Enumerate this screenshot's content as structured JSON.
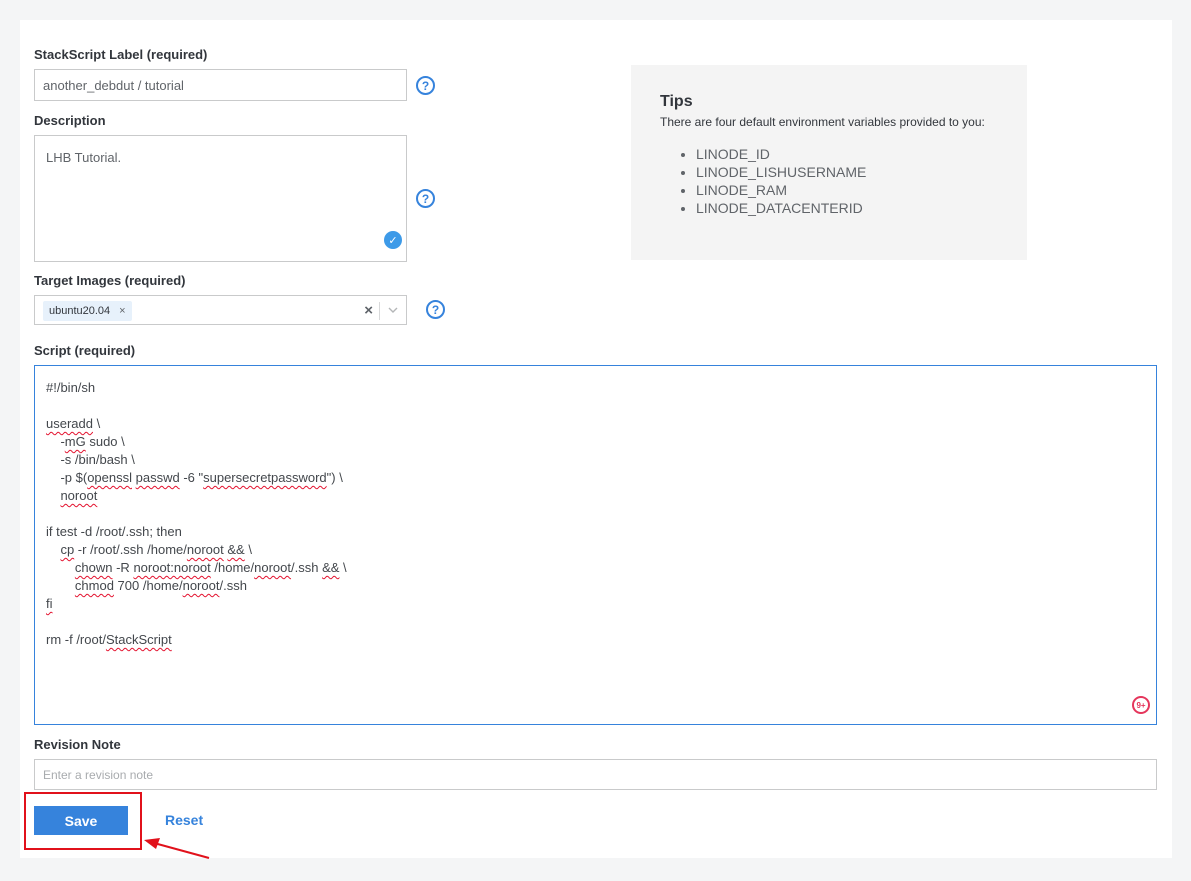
{
  "form": {
    "label_title": "StackScript Label (required)",
    "label_value": "another_debdut /   tutorial",
    "description_title": "Description",
    "description_value": "LHB Tutorial.",
    "images_title": "Target Images (required)",
    "image_chip": "ubuntu20.04",
    "chip_remove": "×",
    "select_clear": "×",
    "help_glyph": "?",
    "script_title": "Script (required)",
    "grammarly_badge": "9+",
    "revision_title": "Revision Note",
    "revision_placeholder": "Enter a revision note"
  },
  "script": {
    "lines": [
      [
        {
          "t": "#!/bin/sh"
        }
      ],
      [],
      [
        {
          "t": "useradd",
          "sp": true
        },
        {
          "t": " \\"
        }
      ],
      [
        {
          "t": "    -"
        },
        {
          "t": "mG",
          "sp": true
        },
        {
          "t": " sudo \\"
        }
      ],
      [
        {
          "t": "    -s /bin/bash \\"
        }
      ],
      [
        {
          "t": "    -p $("
        },
        {
          "t": "openssl",
          "sp": true
        },
        {
          "t": " "
        },
        {
          "t": "passwd",
          "sp": true
        },
        {
          "t": " -6 \""
        },
        {
          "t": "supersecretpassword",
          "sp": true
        },
        {
          "t": "\") \\"
        }
      ],
      [
        {
          "t": "    "
        },
        {
          "t": "noroot",
          "sp": true
        }
      ],
      [],
      [
        {
          "t": "if test -d /root/.ssh; then"
        }
      ],
      [
        {
          "t": "    "
        },
        {
          "t": "cp",
          "sp": true
        },
        {
          "t": " -r /root/.ssh /home/"
        },
        {
          "t": "noroot",
          "sp": true
        },
        {
          "t": " "
        },
        {
          "t": "&&",
          "sp": true
        },
        {
          "t": " \\"
        }
      ],
      [
        {
          "t": "        "
        },
        {
          "t": "chown",
          "sp": true
        },
        {
          "t": " -R "
        },
        {
          "t": "noroot:noroot",
          "sp": true
        },
        {
          "t": " /home/"
        },
        {
          "t": "noroot",
          "sp": true
        },
        {
          "t": "/.ssh "
        },
        {
          "t": "&&",
          "sp": true
        },
        {
          "t": " \\"
        }
      ],
      [
        {
          "t": "        "
        },
        {
          "t": "chmod",
          "sp": true
        },
        {
          "t": " 700 /home/"
        },
        {
          "t": "noroot",
          "sp": true
        },
        {
          "t": "/.ssh"
        }
      ],
      [
        {
          "t": "fi",
          "sp": true
        }
      ],
      [],
      [
        {
          "t": "rm -f /root/"
        },
        {
          "t": "StackScript",
          "sp": true
        }
      ]
    ]
  },
  "actions": {
    "save_label": "Save",
    "reset_label": "Reset"
  },
  "tips": {
    "title": "Tips",
    "text": "There are four default environment variables provided to you:",
    "items": [
      "LINODE_ID",
      "LINODE_LISHUSERNAME",
      "LINODE_RAM",
      "LINODE_DATACENTERID"
    ]
  },
  "colors": {
    "accent": "#3683dc",
    "annotation": "#e1111b",
    "spellcheck": "#e3112e"
  }
}
